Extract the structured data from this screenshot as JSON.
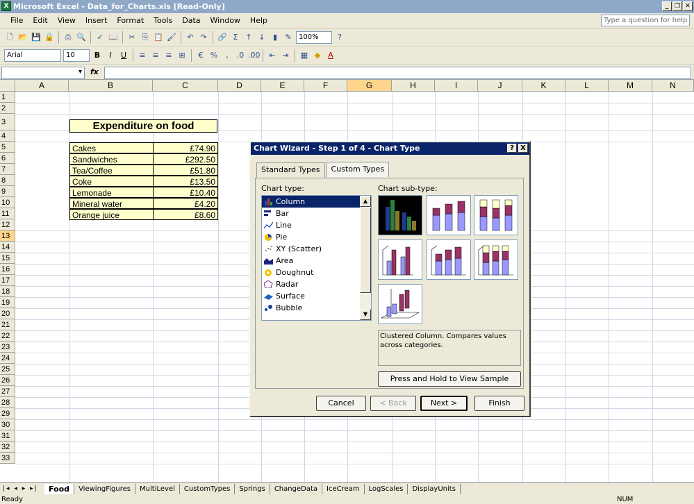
{
  "window": {
    "title": "Microsoft Excel - Data_for_Charts.xls  [Read-Only]"
  },
  "menu": {
    "items": [
      "File",
      "Edit",
      "View",
      "Insert",
      "Format",
      "Tools",
      "Data",
      "Window",
      "Help"
    ],
    "help_placeholder": "Type a question for help"
  },
  "toolbar": {
    "zoom": "100%",
    "font": "Arial",
    "font_size": "10"
  },
  "sheet": {
    "columns": [
      "A",
      "B",
      "C",
      "D",
      "E",
      "F",
      "G",
      "H",
      "I",
      "J",
      "K",
      "L",
      "M",
      "N"
    ],
    "selected_column": "G",
    "selected_row": "13",
    "rows": [
      "1",
      "2",
      "3",
      "4",
      "5",
      "6",
      "7",
      "8",
      "9",
      "10",
      "11",
      "12",
      "13",
      "14",
      "15",
      "16",
      "17",
      "18",
      "19",
      "20",
      "21",
      "22",
      "23",
      "24",
      "25",
      "26",
      "27",
      "28",
      "29",
      "30",
      "31",
      "32",
      "33"
    ],
    "table_title": "Expenditure on food",
    "items": [
      {
        "name": "Cakes",
        "value": "£74.90"
      },
      {
        "name": "Sandwiches",
        "value": "£292.50"
      },
      {
        "name": "Tea/Coffee",
        "value": "£51.80"
      },
      {
        "name": "Coke",
        "value": "£13.50"
      },
      {
        "name": "Lemonade",
        "value": "£10.40"
      },
      {
        "name": "Mineral water",
        "value": "£4.20"
      },
      {
        "name": "Orange juice",
        "value": "£8.60"
      }
    ]
  },
  "dialog": {
    "title": "Chart Wizard - Step 1 of 4 - Chart Type",
    "help_btn": "?",
    "close_btn": "X",
    "tabs": [
      "Standard Types",
      "Custom Types"
    ],
    "chart_type_label": "Chart type:",
    "subtype_label": "Chart sub-type:",
    "chart_types": [
      "Column",
      "Bar",
      "Line",
      "Pie",
      "XY (Scatter)",
      "Area",
      "Doughnut",
      "Radar",
      "Surface",
      "Bubble"
    ],
    "selected_type": "Column",
    "description": "Clustered Column. Compares values across categories.",
    "sample_btn": "Press and Hold to View Sample",
    "cancel": "Cancel",
    "back": "< Back",
    "next": "Next >",
    "finish": "Finish"
  },
  "sheet_tabs": [
    "Food",
    "ViewingFigures",
    "MultiLevel",
    "CustomTypes",
    "Springs",
    "ChangeData",
    "IceCream",
    "LogScales",
    "DisplayUnits"
  ],
  "status": {
    "left": "Ready",
    "num": "NUM"
  }
}
